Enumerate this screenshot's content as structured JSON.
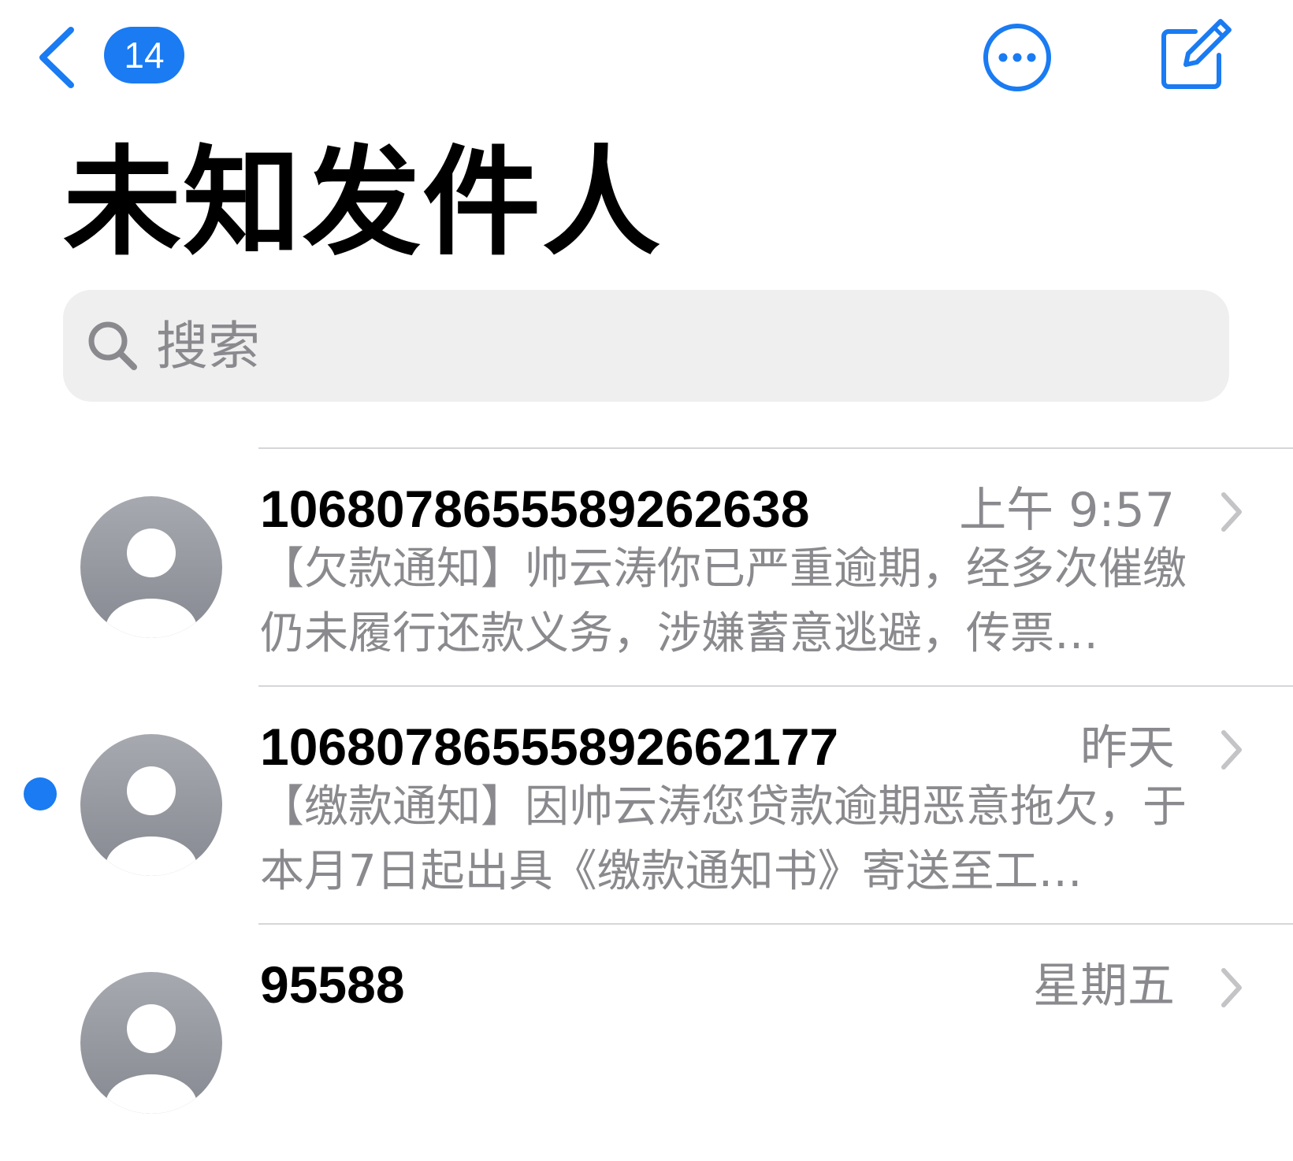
{
  "header": {
    "badge_count": "14",
    "title": "未知发件人"
  },
  "search": {
    "placeholder": "搜索"
  },
  "colors": {
    "accent": "#1a7bf2",
    "secondary_text": "#8a8a8e",
    "search_bg": "#efeff0"
  },
  "icons": {
    "back": "chevron-left-icon",
    "more": "ellipsis-circle-icon",
    "compose": "compose-icon",
    "search": "search-icon",
    "avatar": "person-avatar-icon",
    "disclosure": "chevron-right-icon"
  },
  "messages": [
    {
      "sender": "106807865558926263​8",
      "time": "上午 9:57",
      "preview": "【欠款通知】帅云涛你已严重逾期，经多次催缴仍未履行还款义务，涉嫌蓄意逃避，传票…",
      "unread": false
    },
    {
      "sender": "106807865558926621​77",
      "time": "昨天",
      "preview": "【缴款通知】因帅云涛您贷款逾期恶意拖欠，于本月7日起出具《缴款通知书》寄送至工…",
      "unread": true
    },
    {
      "sender": "95588",
      "time": "星期五",
      "preview": "",
      "unread": false
    }
  ]
}
